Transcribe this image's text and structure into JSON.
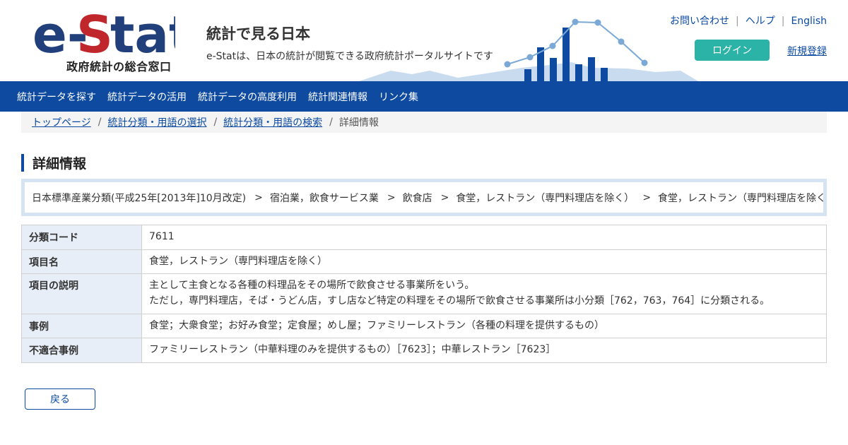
{
  "header": {
    "logo_text": "e-Stat",
    "logo_subtitle": "政府統計の総合窓口",
    "tagline_title": "統計で見る日本",
    "tagline_desc": "e-Statは、日本の統計が閲覧できる政府統計ポータルサイトです",
    "util_links": {
      "contact": "お問い合わせ",
      "help": "ヘルプ",
      "english": "English",
      "separator": "|"
    },
    "login_label": "ログイン",
    "register_label": "新規登録"
  },
  "nav": {
    "items": [
      "統計データを探す",
      "統計データの活用",
      "統計データの高度利用",
      "統計関連情報",
      "リンク集"
    ]
  },
  "breadcrumb": {
    "items": [
      "トップページ",
      "統計分類・用語の選択",
      "統計分類・用語の検索"
    ],
    "current": "詳細情報",
    "separator": "/"
  },
  "page_title": "詳細情報",
  "path": {
    "items": [
      "日本標準産業分類(平成25年[2013年]10月改定)",
      "宿泊業，飲食サービス業",
      "飲食店",
      "食堂，レストラン（専門料理店を除く）",
      "食堂，レストラン（専門料理店を除く）"
    ],
    "separator": ">"
  },
  "details": {
    "code_label": "分類コード",
    "code_value": "7611",
    "name_label": "項目名",
    "name_value": "食堂，レストラン（専門料理店を除く）",
    "desc_label": "項目の説明",
    "desc_line1": "主として主食となる各種の料理品をその場所で飲食させる事業所をいう。",
    "desc_line2": "ただし，専門料理店，そば・うどん店，すし店など特定の料理をその場所で飲食させる事業所は小分類［762，763，764］に分類される。",
    "examples_label": "事例",
    "examples_value": "食堂；大衆食堂；お好み食堂；定食屋；めし屋；ファミリーレストラン（各種の料理を提供するもの）",
    "non_examples_label": "不適合事例",
    "non_examples_value": "ファミリーレストラン（中華料理のみを提供するもの）［7623］；中華レストラン［7623］"
  },
  "back_label": "戻る",
  "colors": {
    "brand_blue": "#0d4aa0",
    "logo_red": "#c0272d",
    "login_teal": "#2ab3a6",
    "link_blue": "#0b4aa2"
  }
}
